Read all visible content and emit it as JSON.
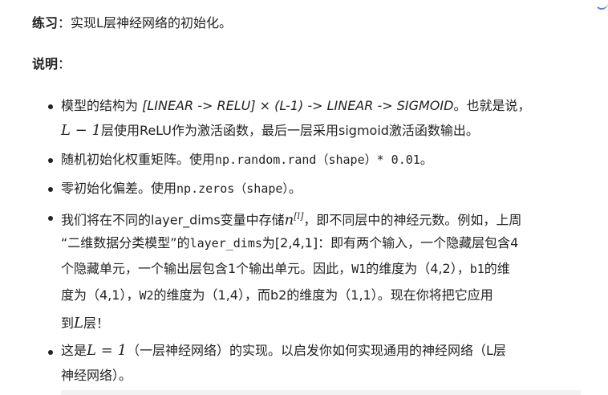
{
  "exercise": {
    "label": "练习",
    "sep": "：",
    "text": "实现L层神经网络的初始化。"
  },
  "explain": {
    "label": "说明",
    "sep": "："
  },
  "b1": {
    "pre": "模型的结构为 ",
    "struct": "[LINEAR -> RELU] × (L-1) -> LINEAR -> SIGMOID",
    "post": "。也就是说，",
    "math": "L − 1",
    "line2": "层使用ReLU作为激活函数，最后一层采用sigmoid激活函数输出。"
  },
  "b2": {
    "pre": "随机初始化权重矩阵。使用",
    "code": "np.random.rand（shape）* 0.01",
    "post": "。"
  },
  "b3": {
    "pre": "零初始化偏差。使用",
    "code": "np.zeros（shape）",
    "post": "。"
  },
  "b4": {
    "l1_pre": "我们将在不同的layer_dims变量中存储",
    "n": "n",
    "nsup": "[l]",
    "l1_post": "，即不同层中的神经元数。例如，上周",
    "l2_pre": "“二维数据分类模型”的",
    "l2_code": "layer_dims",
    "l2_post": "为[2,4,1]：即有两个输入，一个隐藏层包含4",
    "l3": "个隐藏单元，一个输出层包含1个输出单元。因此，",
    "l3_w1": "W1",
    "l3_mid": "的维度为（4,2），",
    "l3_b1": "b1",
    "l3_post": "的维",
    "l4_pre": "度为（4,1），",
    "l4_w2": "W2",
    "l4_post": "的维度为（1,4），而b2的维度为（1,1）。现在你将把它应用",
    "l5_pre": "到",
    "l5_L": "L",
    "l5_post": "层！"
  },
  "b5": {
    "pre": "这是",
    "math": "L = 1",
    "post": "（一层神经网络）的实现。以启发你如何实现通用的神经网络（L层",
    "line2": "神经网络）。"
  }
}
